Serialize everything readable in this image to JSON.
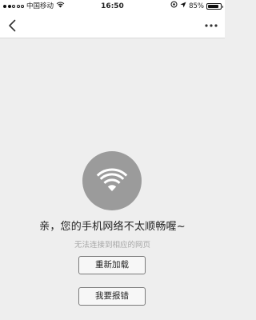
{
  "status_bar": {
    "signal_dots_filled": 2,
    "signal_dots_total": 5,
    "carrier": "中国移动",
    "time": "16:50",
    "battery_percent": "85%",
    "battery_level": 0.85
  },
  "nav": {
    "back_icon": "chevron-left-icon",
    "more_icon": "more-dots-icon"
  },
  "error": {
    "icon": "wifi-icon",
    "message": "亲，您的手机网络不太顺畅喔~",
    "detail": "无法连接到相应的网页"
  },
  "actions": {
    "reload_label": "重新加载",
    "report_label": "我要报错"
  },
  "colors": {
    "background": "#eeeeee",
    "icon_circle": "#9b9b9b",
    "detail_text": "#a6a6a6"
  }
}
